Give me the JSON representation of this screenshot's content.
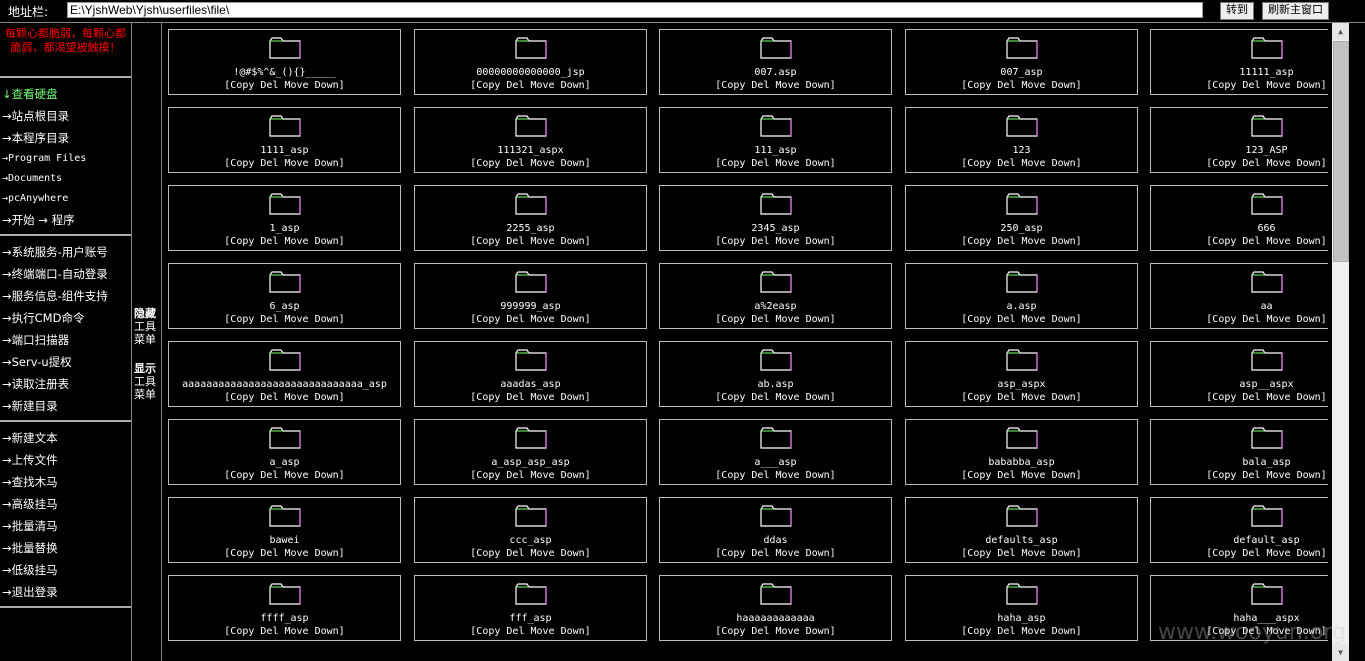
{
  "topbar": {
    "address_label": "地址栏:",
    "address_value": "E:\\YjshWeb\\Yjsh\\userfiles\\file\\",
    "go_label": "转到",
    "refresh_label": "刷新主窗口"
  },
  "sidebar": {
    "slogan": "每颗心都脆弱，每颗心都脆弱，都渴望被触摸！",
    "groups": [
      [
        {
          "label": "↓查看硬盘",
          "green": true
        },
        {
          "label": "→站点根目录"
        },
        {
          "label": "→本程序目录"
        },
        {
          "label": "→Program Files",
          "small": true
        },
        {
          "label": "→Documents",
          "small": true
        },
        {
          "label": "→pcAnywhere",
          "small": true
        },
        {
          "label": "→开始 → 程序"
        }
      ],
      [
        {
          "label": "→系统服务-用户账号"
        },
        {
          "label": "→终端端口-自动登录"
        },
        {
          "label": "→服务信息-组件支持"
        },
        {
          "label": "→执行CMD命令"
        },
        {
          "label": "→端口扫描器"
        },
        {
          "label": "→Serv-u提权"
        },
        {
          "label": "→读取注册表"
        },
        {
          "label": "→新建目录"
        }
      ],
      [
        {
          "label": "→新建文本"
        },
        {
          "label": "→上传文件"
        },
        {
          "label": "→查找木马"
        },
        {
          "label": "→高级挂马"
        },
        {
          "label": "→批量清马"
        },
        {
          "label": "→批量替换"
        },
        {
          "label": "→低级挂马"
        },
        {
          "label": "→退出登录"
        }
      ]
    ]
  },
  "toggles": {
    "hide": {
      "bold": "隐藏",
      "rest": "工具菜单"
    },
    "show": {
      "bold": "显示",
      "rest": "工具菜单"
    }
  },
  "actions_label": "[Copy Del Move Down]",
  "files": [
    "!@#$%^&_(){}_____",
    "00000000000000_jsp",
    "007.asp",
    "007_asp",
    "11111_asp",
    "1111_asp",
    "111321_aspx",
    "111_asp",
    "123",
    "123_ASP",
    "1_asp",
    "2255_asp",
    "2345_asp",
    "250_asp",
    "666",
    "6_asp",
    "999999_asp",
    "a%2easp",
    "a.asp",
    "aa",
    "aaaaaaaaaaaaaaaaaaaaaaaaaaaaaa_asp",
    "aaadas_asp",
    "ab.asp",
    "asp_aspx",
    "asp__aspx",
    "a_asp",
    "a_asp_asp_asp",
    "a___asp",
    "bababba_asp",
    "bala_asp",
    "bawei",
    "ccc_asp",
    "ddas",
    "defaults_asp",
    "default_asp",
    "ffff_asp",
    "fff_asp",
    "haaaaaaaaaaaa",
    "haha_asp",
    "haha___aspx"
  ],
  "watermark": "www.wooyun.org",
  "colors": {
    "background": "#000000",
    "slogan": "#ff0000",
    "accent_green": "#77ff77"
  }
}
